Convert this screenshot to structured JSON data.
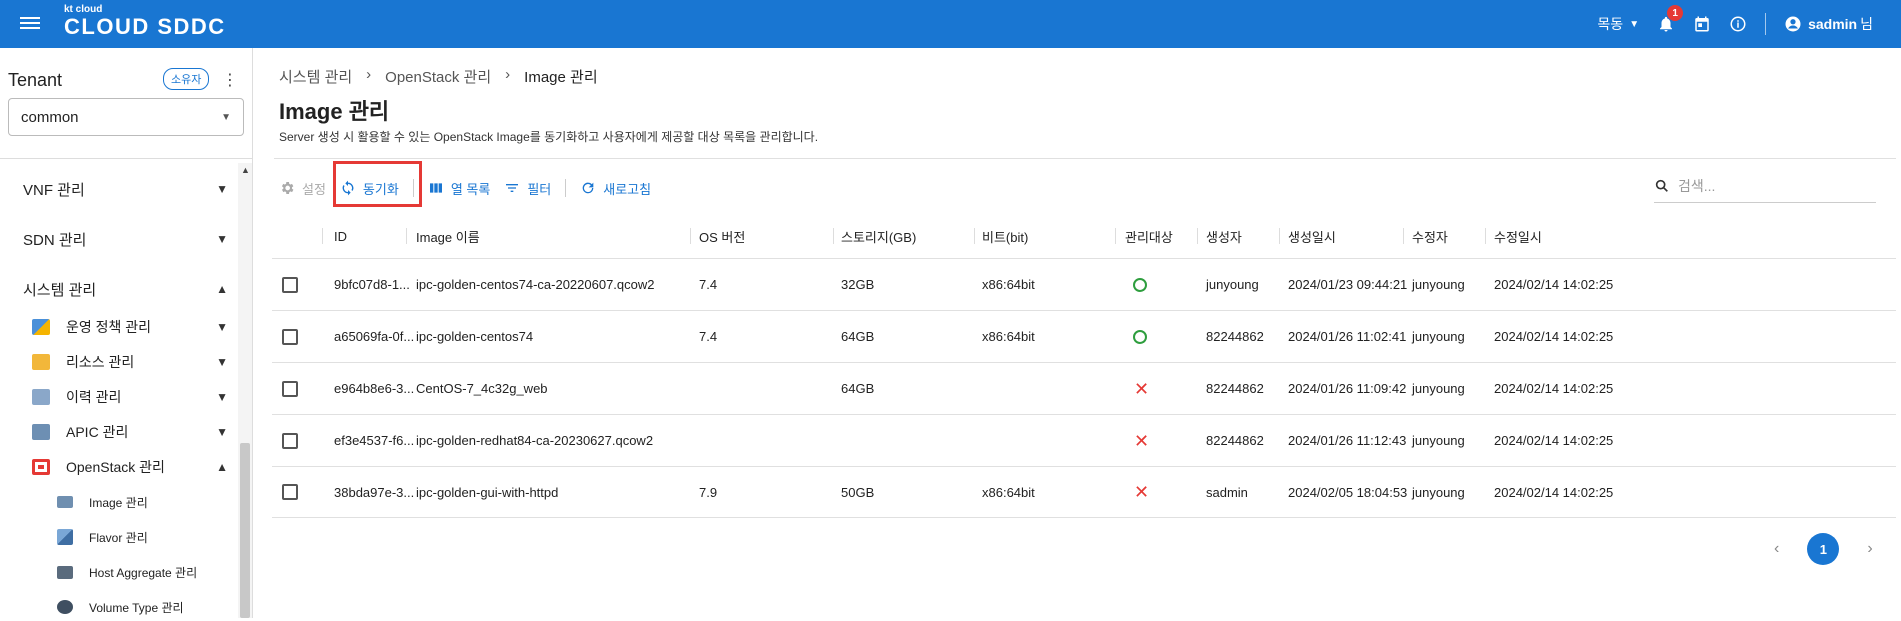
{
  "header": {
    "logo_small": "kt cloud",
    "logo_big": "CLOUD SDDC",
    "region": "목동",
    "notification_count": "1",
    "user": "sadmin",
    "user_suffix": "님"
  },
  "sidebar": {
    "tenant_title": "Tenant",
    "owner_chip": "소유자",
    "tenant_value": "common",
    "menu": [
      {
        "label": "VNF 관리",
        "icon": "",
        "expanded": false
      },
      {
        "label": "SDN 관리",
        "icon": "",
        "expanded": false
      },
      {
        "label": "시스템 관리",
        "icon": "",
        "expanded": true
      },
      {
        "label": "운영 정책 관리",
        "icon": "policy-icon",
        "expanded": false
      },
      {
        "label": "리소스 관리",
        "icon": "folder-icon",
        "expanded": false
      },
      {
        "label": "이력 관리",
        "icon": "history-icon",
        "expanded": false
      },
      {
        "label": "APIC 관리",
        "icon": "monitor-icon",
        "expanded": false
      },
      {
        "label": "OpenStack 관리",
        "icon": "openstack-icon",
        "expanded": true
      },
      {
        "label": "Image 관리",
        "icon": "image-icon"
      },
      {
        "label": "Flavor 관리",
        "icon": "flavor-icon"
      },
      {
        "label": "Host Aggregate 관리",
        "icon": "host-aggregate-icon"
      },
      {
        "label": "Volume Type 관리",
        "icon": "volume-icon"
      }
    ]
  },
  "breadcrumb": [
    "시스템 관리",
    "OpenStack 관리",
    "Image 관리"
  ],
  "page": {
    "title": "Image 관리",
    "description": "Server 생성 시 활용할 수 있는 OpenStack Image를 동기화하고 사용자에게 제공할 대상 목록을 관리합니다."
  },
  "toolbar": {
    "settings": "설정",
    "sync": "동기화",
    "columns": "열 목록",
    "filter": "필터",
    "refresh": "새로고침",
    "search_placeholder": "검색..."
  },
  "table": {
    "columns": [
      "ID",
      "Image 이름",
      "OS 버전",
      "스토리지(GB)",
      "비트(bit)",
      "관리대상",
      "생성자",
      "생성일시",
      "수정자",
      "수정일시"
    ],
    "rows": [
      {
        "id": "9bfc07d8-1...",
        "name": "ipc-golden-centos74-ca-20220607.qcow2",
        "os": "7.4",
        "storage": "32GB",
        "bit": "x86:64bit",
        "managed": true,
        "creator": "junyoung",
        "created": "2024/01/23 09:44:21",
        "modifier": "junyoung",
        "modified": "2024/02/14 14:02:25"
      },
      {
        "id": "a65069fa-0f...",
        "name": "ipc-golden-centos74",
        "os": "7.4",
        "storage": "64GB",
        "bit": "x86:64bit",
        "managed": true,
        "creator": "82244862",
        "created": "2024/01/26 11:02:41",
        "modifier": "junyoung",
        "modified": "2024/02/14 14:02:25"
      },
      {
        "id": "e964b8e6-3...",
        "name": "CentOS-7_4c32g_web",
        "os": "",
        "storage": "64GB",
        "bit": "",
        "managed": false,
        "creator": "82244862",
        "created": "2024/01/26 11:09:42",
        "modifier": "junyoung",
        "modified": "2024/02/14 14:02:25"
      },
      {
        "id": "ef3e4537-f6...",
        "name": "ipc-golden-redhat84-ca-20230627.qcow2",
        "os": "",
        "storage": "",
        "bit": "",
        "managed": false,
        "creator": "82244862",
        "created": "2024/01/26 11:12:43",
        "modifier": "junyoung",
        "modified": "2024/02/14 14:02:25"
      },
      {
        "id": "38bda97e-3...",
        "name": "ipc-golden-gui-with-httpd",
        "os": "7.9",
        "storage": "50GB",
        "bit": "x86:64bit",
        "managed": false,
        "creator": "sadmin",
        "created": "2024/02/05 18:04:53",
        "modifier": "junyoung",
        "modified": "2024/02/14 14:02:25"
      }
    ]
  },
  "pagination": {
    "current": "1",
    "prev": "‹",
    "next": "›"
  }
}
